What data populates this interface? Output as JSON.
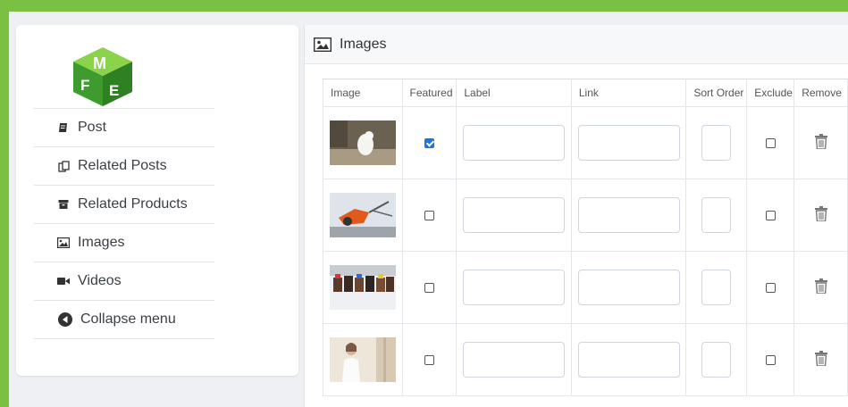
{
  "colors": {
    "border_green": "#7ac143",
    "logo_green": "#4caf50",
    "checkbox_blue": "#1a73e8"
  },
  "sidebar": {
    "logo_icon": "fme-cube-logo",
    "items": [
      {
        "label": "Post",
        "icon": "post-icon"
      },
      {
        "label": "Related Posts",
        "icon": "related-posts-icon"
      },
      {
        "label": "Related Products",
        "icon": "archive-icon"
      },
      {
        "label": "Images",
        "icon": "image-icon"
      },
      {
        "label": "Videos",
        "icon": "video-icon"
      },
      {
        "label": "Collapse menu",
        "icon": "collapse-circle-icon"
      }
    ]
  },
  "panel": {
    "title": "Images",
    "title_icon": "image-icon",
    "columns": [
      "Image",
      "Featured",
      "Label",
      "Link",
      "Sort Order",
      "Exclude",
      "Remove"
    ],
    "rows": [
      {
        "thumbnail": "snowy-owl-photo",
        "featured": true,
        "label": "",
        "link": "",
        "sort_order": "",
        "exclude": false
      },
      {
        "thumbnail": "orange-robot-photo",
        "featured": false,
        "label": "",
        "link": "",
        "sort_order": "",
        "exclude": false
      },
      {
        "thumbnail": "horse-race-photo",
        "featured": false,
        "label": "",
        "link": "",
        "sort_order": "",
        "exclude": false
      },
      {
        "thumbnail": "woman-portrait-photo",
        "featured": false,
        "label": "",
        "link": "",
        "sort_order": "",
        "exclude": false
      }
    ]
  }
}
